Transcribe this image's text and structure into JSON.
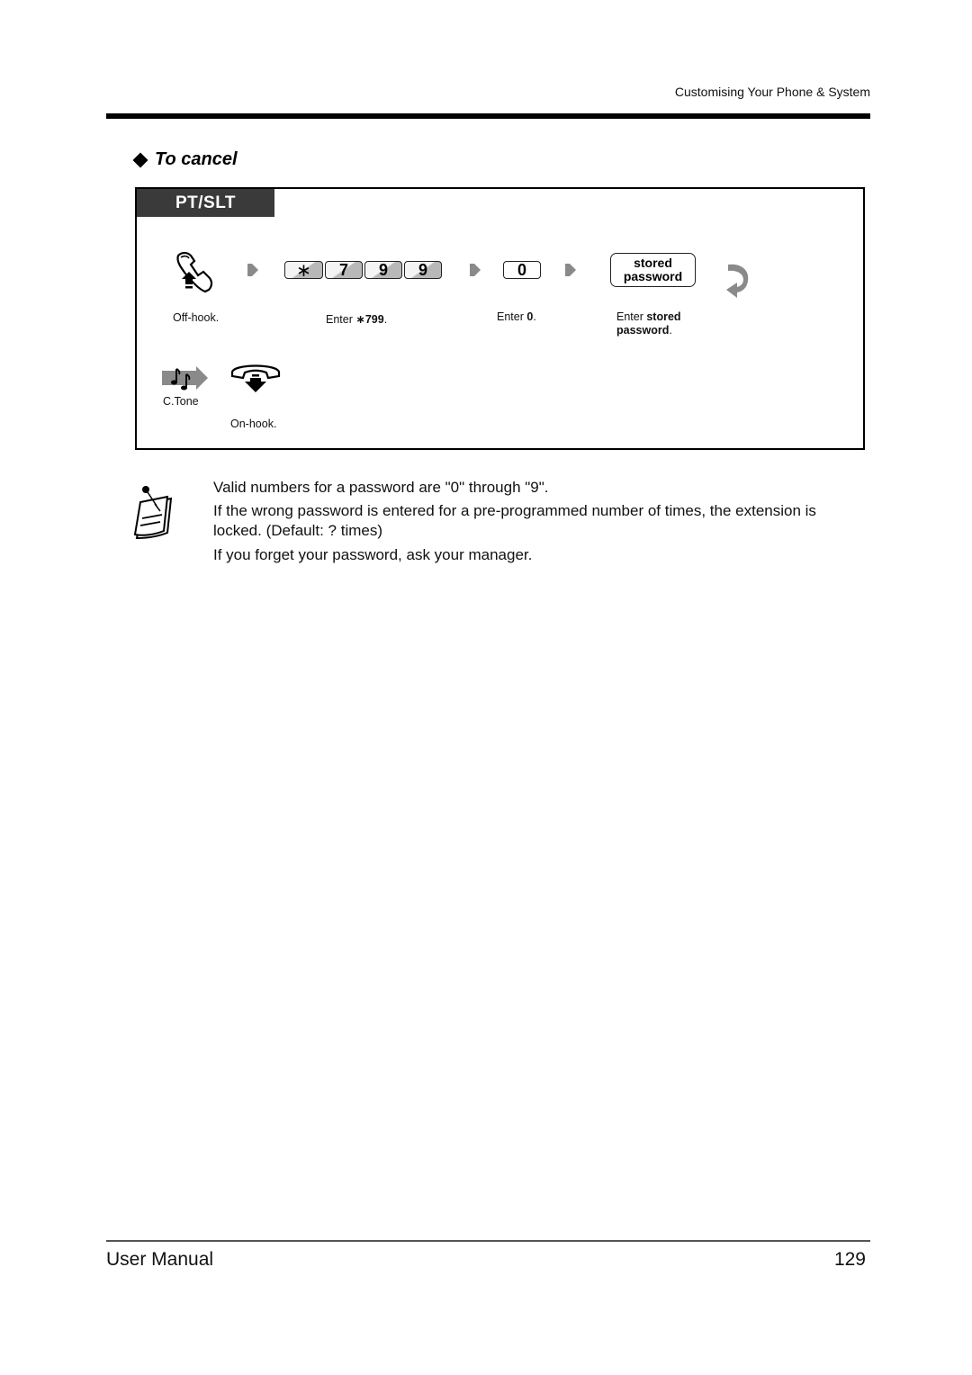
{
  "header": {
    "section_name": "Customising Your Phone & System"
  },
  "section": {
    "title": "To cancel"
  },
  "procedure": {
    "mode_label": "PT/SLT",
    "steps": [
      {
        "icon": "off-hook-icon",
        "caption": "Off-hook."
      },
      {
        "keys": [
          "∗",
          "7",
          "9",
          "9"
        ],
        "caption_prefix": "Enter ",
        "caption_bold": "∗799",
        "caption_suffix": "."
      },
      {
        "keys": [
          "0"
        ],
        "caption_prefix": "Enter ",
        "caption_bold": "0",
        "caption_suffix": "."
      },
      {
        "key_label_line1": "stored",
        "key_label_line2": "password",
        "caption_prefix": "Enter ",
        "caption_bold_1": "stored",
        "caption_bold_2": "password",
        "caption_suffix": "."
      }
    ],
    "tone_label": "C.Tone",
    "on_hook_caption": "On-hook."
  },
  "notes": [
    "Valid numbers for a password are \"0\" through \"9\".",
    "If the wrong password is entered for a pre-programmed number of times, the extension is locked. (Default: ? times)",
    "If you forget your password, ask your manager."
  ],
  "footer": {
    "left": "User Manual",
    "page_number": "129"
  },
  "colors": {
    "tab_background": "#3a3a3a",
    "arrow_gray": "#8a8a8a",
    "key_shade": "#b8b8b8"
  }
}
